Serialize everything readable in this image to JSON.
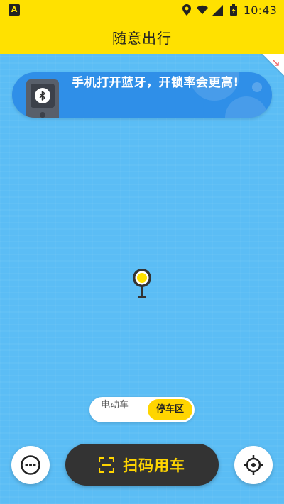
{
  "status_bar": {
    "app_badge": "A",
    "time": "10:43",
    "icons": [
      "location-icon",
      "wifi-icon",
      "signal-icon",
      "battery-icon"
    ]
  },
  "header": {
    "title": "随意出行"
  },
  "bluetooth_banner": {
    "text": "手机打开蓝牙，开锁率会更高!",
    "icon": "bluetooth-icon"
  },
  "vehicle_toggle": {
    "options": [
      "电动车",
      "停车区"
    ],
    "selected": "停车区"
  },
  "actions": {
    "scan_label": "扫码用车",
    "more_icon": "more-icon",
    "locate_icon": "locate-icon"
  },
  "colors": {
    "brand_yellow": "#ffe100",
    "map_blue": "#5bbdf5",
    "banner_blue": "#2f8fe8",
    "button_dark": "#333333",
    "accent_yellow": "#ffd500"
  }
}
